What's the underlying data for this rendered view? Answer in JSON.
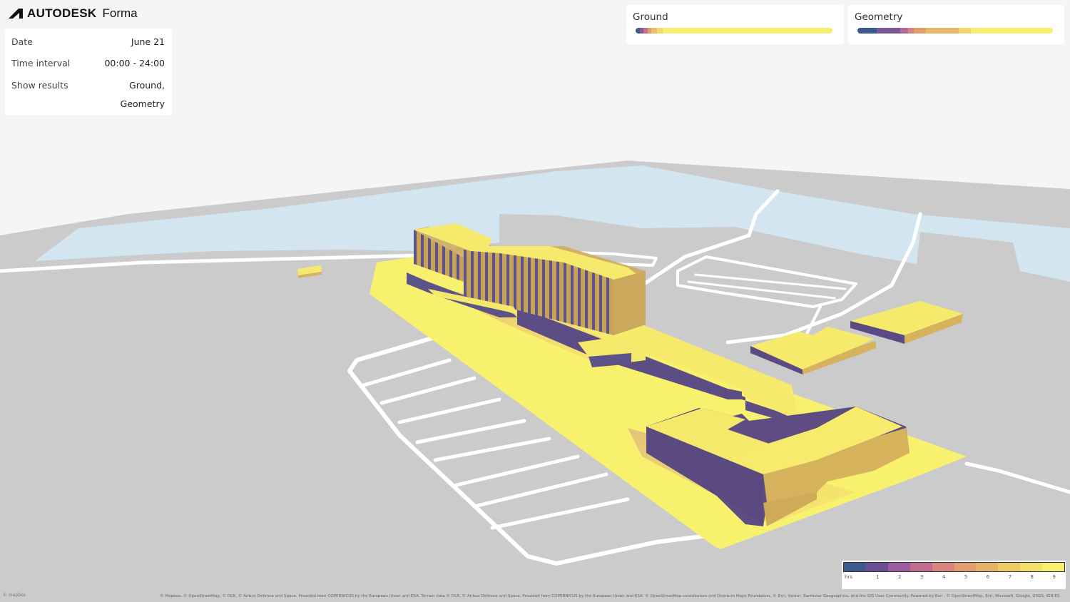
{
  "app": {
    "brand": "AUTODESK",
    "product": "Forma"
  },
  "settings": {
    "date_label": "Date",
    "date_value": "June 21",
    "interval_label": "Time interval",
    "interval_value": "00:00 - 24:00",
    "results_label": "Show results",
    "results_value_line1": "Ground,",
    "results_value_line2": "Geometry"
  },
  "legends": {
    "ground_title": "Ground",
    "geometry_title": "Geometry"
  },
  "scale": {
    "unit": "hrs",
    "ticks": [
      "1",
      "2",
      "3",
      "4",
      "5",
      "6",
      "7",
      "8",
      "9"
    ],
    "colors": [
      "#3d5a8c",
      "#6a4f93",
      "#9b5d9d",
      "#c16c8f",
      "#d9857d",
      "#e19d6f",
      "#e6b466",
      "#ecca66",
      "#f2df6a",
      "#f7f06e"
    ]
  },
  "attribution": "© Mapbox, © OpenStreetMap, © DLR, © Airbus Defence and Space. Provided from COPERNICUS by the European Union and ESA. Terrain data © DLR, © Airbus Defence and Space. Provided from COPERNICUS by the European Union and ESA. © OpenStreetMap contributors and Overture Maps Foundation, © Esri, Vantor, Earthstar Geographics, and the GIS User Community. Powered by Esri . © OpenStreetMap, Esri, Microsoft, Google, USGS, IGN ES",
  "mapbox_logo": "© mapbox",
  "colors": {
    "ground": "#c8c8c8",
    "water": "#d4e6f1",
    "road": "#ffffff",
    "sun": "#f7ef6c",
    "shade": "#634c80",
    "wall": "#d4b05c"
  }
}
